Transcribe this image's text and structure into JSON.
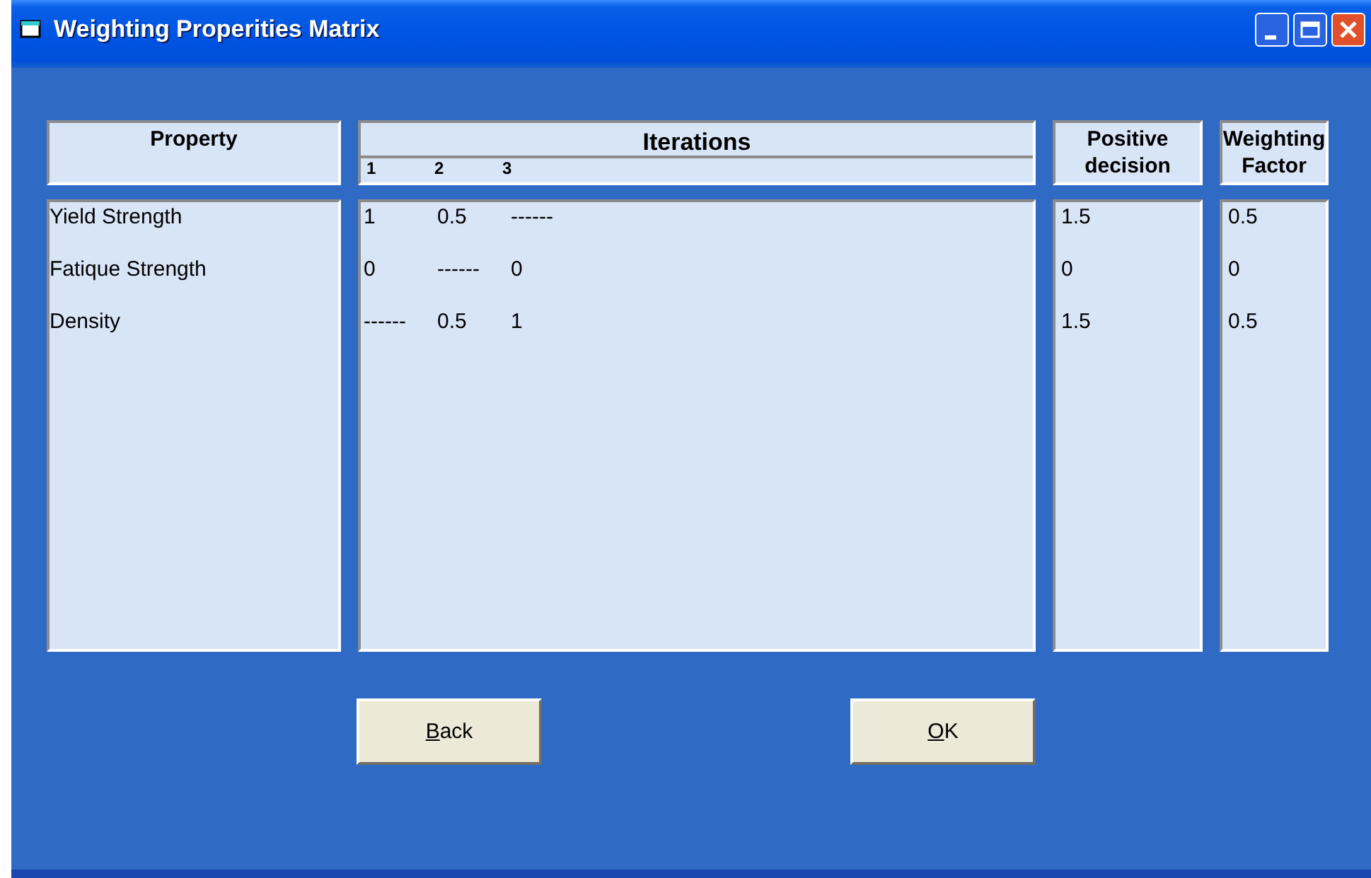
{
  "window": {
    "title": "Weighting Properities Matrix"
  },
  "headers": {
    "property": "Property",
    "iterations": "Iterations",
    "iteration_numbers": [
      "1",
      "2",
      "3"
    ],
    "positive": "Positive decision",
    "weighting": "Weighting Factor"
  },
  "rows": [
    {
      "property": "Yield Strength",
      "iterations": [
        "1",
        "0.5",
        "------"
      ],
      "positive": "1.5",
      "weighting": "0.5"
    },
    {
      "property": "Fatique Strength",
      "iterations": [
        "0",
        "------",
        "0"
      ],
      "positive": "0",
      "weighting": "0"
    },
    {
      "property": "Density",
      "iterations": [
        "------",
        "0.5",
        "1"
      ],
      "positive": "1.5",
      "weighting": "0.5"
    }
  ],
  "buttons": [
    {
      "mnemonic": "B",
      "rest": "ack"
    },
    {
      "mnemonic": "O",
      "rest": "K"
    }
  ]
}
